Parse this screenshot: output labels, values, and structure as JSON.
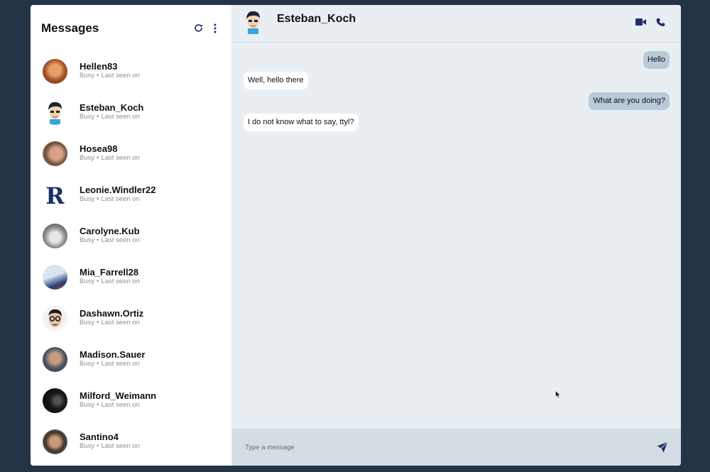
{
  "sidebar": {
    "title": "Messages",
    "refresh_icon": "refresh-icon",
    "more_icon": "more-vertical-icon",
    "contacts": [
      {
        "name": "Hellen83",
        "status": "Busy",
        "last_seen": "Last seen on",
        "avatar": "photo-avatar"
      },
      {
        "name": "Esteban_Koch",
        "status": "Busy",
        "last_seen": "Last seen on",
        "avatar": "cartoon-avatar"
      },
      {
        "name": "Hosea98",
        "status": "Busy",
        "last_seen": "Last seen on",
        "avatar": "photo-avatar"
      },
      {
        "name": "Leonie.Windler22",
        "status": "Busy",
        "last_seen": "Last seen on",
        "avatar": "letter-r-logo-avatar"
      },
      {
        "name": "Carolyne.Kub",
        "status": "Busy",
        "last_seen": "Last seen on",
        "avatar": "photo-avatar"
      },
      {
        "name": "Mia_Farrell28",
        "status": "Busy",
        "last_seen": "Last seen on",
        "avatar": "photo-avatar"
      },
      {
        "name": "Dashawn.Ortiz",
        "status": "Busy",
        "last_seen": "Last seen on",
        "avatar": "photo-avatar"
      },
      {
        "name": "Madison.Sauer",
        "status": "Busy",
        "last_seen": "Last seen on",
        "avatar": "photo-avatar"
      },
      {
        "name": "Milford_Weimann",
        "status": "Busy",
        "last_seen": "Last seen on",
        "avatar": "photo-avatar"
      },
      {
        "name": "Santino4",
        "status": "Busy",
        "last_seen": "Last seen on",
        "avatar": "photo-avatar"
      }
    ],
    "separator": "•"
  },
  "chat": {
    "name": "Esteban_Koch",
    "video_icon": "video-camera-icon",
    "phone_icon": "phone-icon",
    "messages": [
      {
        "text": "Hello",
        "direction": "outgoing"
      },
      {
        "text": "Well, hello there",
        "direction": "incoming"
      },
      {
        "text": "What are you doing?",
        "direction": "outgoing"
      },
      {
        "text": "I do not know what to say, ttyl?",
        "direction": "incoming"
      }
    ],
    "composer_placeholder": "Type a message",
    "send_icon": "send-icon"
  },
  "colors": {
    "background": "#243447",
    "outgoing_bubble": "#b9cadb",
    "incoming_bubble": "#ffffff",
    "chat_bg": "#e9eef3",
    "composer_bg": "#d5dde4",
    "accent": "#1f2d6b"
  }
}
